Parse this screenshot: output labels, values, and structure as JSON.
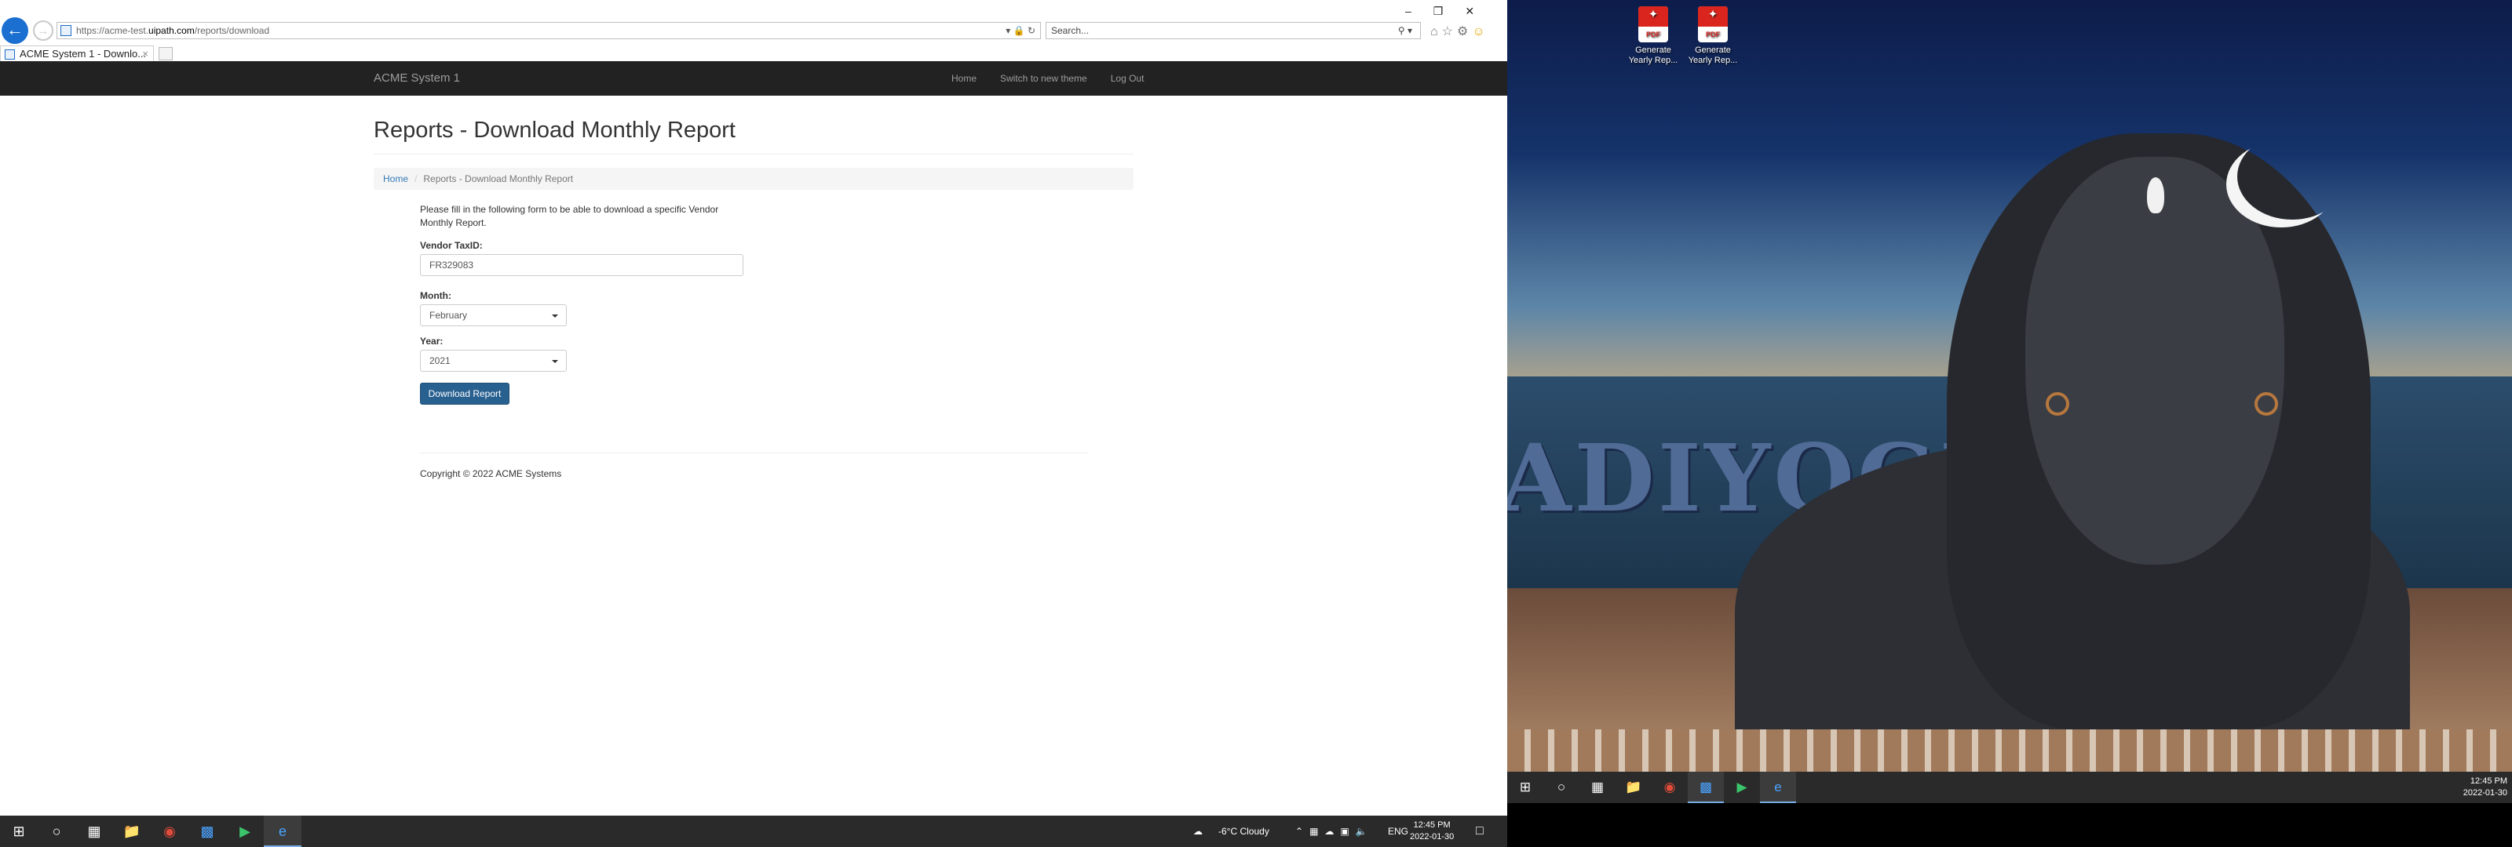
{
  "browser": {
    "url_proto": "https://",
    "url_host_pre": "acme-test.",
    "url_host": "uipath.com",
    "url_path": "/reports/download",
    "search_placeholder": "Search...",
    "tab_title": "ACME System 1 - Downlo...",
    "tab_close": "×"
  },
  "app": {
    "brand": "ACME System 1",
    "nav": {
      "home": "Home",
      "theme": "Switch to new theme",
      "logout": "Log Out"
    },
    "page_title": "Reports - Download Monthly Report",
    "breadcrumb": {
      "home": "Home",
      "current": "Reports - Download Monthly Report",
      "sep": "/"
    },
    "intro": "Please fill in the following form to be able to download a specific Vendor Monthly Report.",
    "form": {
      "vendor_label": "Vendor TaxID:",
      "vendor_value": "FR329083",
      "month_label": "Month:",
      "month_value": "February",
      "year_label": "Year:",
      "year_value": "2021",
      "submit": "Download Report"
    },
    "footer": "Copyright © 2022 ACME Systems"
  },
  "taskbar_left": {
    "weather": "-6°C  Cloudy",
    "lang": "ENG",
    "time": "12:45 PM",
    "date": "2022-01-30"
  },
  "desktop": {
    "wallpaper_text": "ADIYOGI",
    "icons": [
      {
        "label": "Generate Yearly Rep...",
        "badge": "PDF"
      },
      {
        "label": "Generate Yearly Rep...",
        "badge": "PDF"
      }
    ],
    "time": "12:45 PM",
    "date": "2022-01-30"
  },
  "colors": {
    "navbar": "#222222",
    "primary_button": "#286090",
    "link": "#337ab7",
    "taskbar": "#2a2a2a"
  }
}
